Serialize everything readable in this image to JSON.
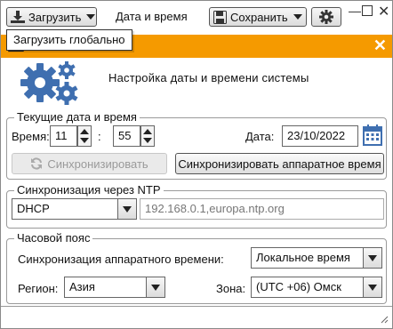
{
  "toolbar": {
    "load_label": "Загрузить",
    "save_label": "Сохранить"
  },
  "window": {
    "title": "Дата и время"
  },
  "tooltip": {
    "text": "Загрузить глобально"
  },
  "banner": {
    "color": "#f59a00"
  },
  "heading": "Настройка даты и времени системы",
  "datetime": {
    "group_label": "Текущие дата и время",
    "time_label": "Время:",
    "hours": "11",
    "separator": ":",
    "minutes": "55",
    "date_label": "Дата:",
    "date": "23/10/2022",
    "sync_label": "Синхронизировать",
    "hw_sync_label": "Синхронизировать аппаратное время"
  },
  "ntp": {
    "group_label": "Синхронизация через NTP",
    "mode": "DHCP",
    "servers": "192.168.0.1,europa.ntp.org"
  },
  "timezone": {
    "group_label": "Часовой пояс",
    "hw_label": "Синхронизация аппаратного времени:",
    "hw_value": "Локальное время",
    "region_label": "Регион:",
    "region_value": "Азия",
    "zone_label": "Зона:",
    "zone_value": "(UTC +06) Омск"
  }
}
